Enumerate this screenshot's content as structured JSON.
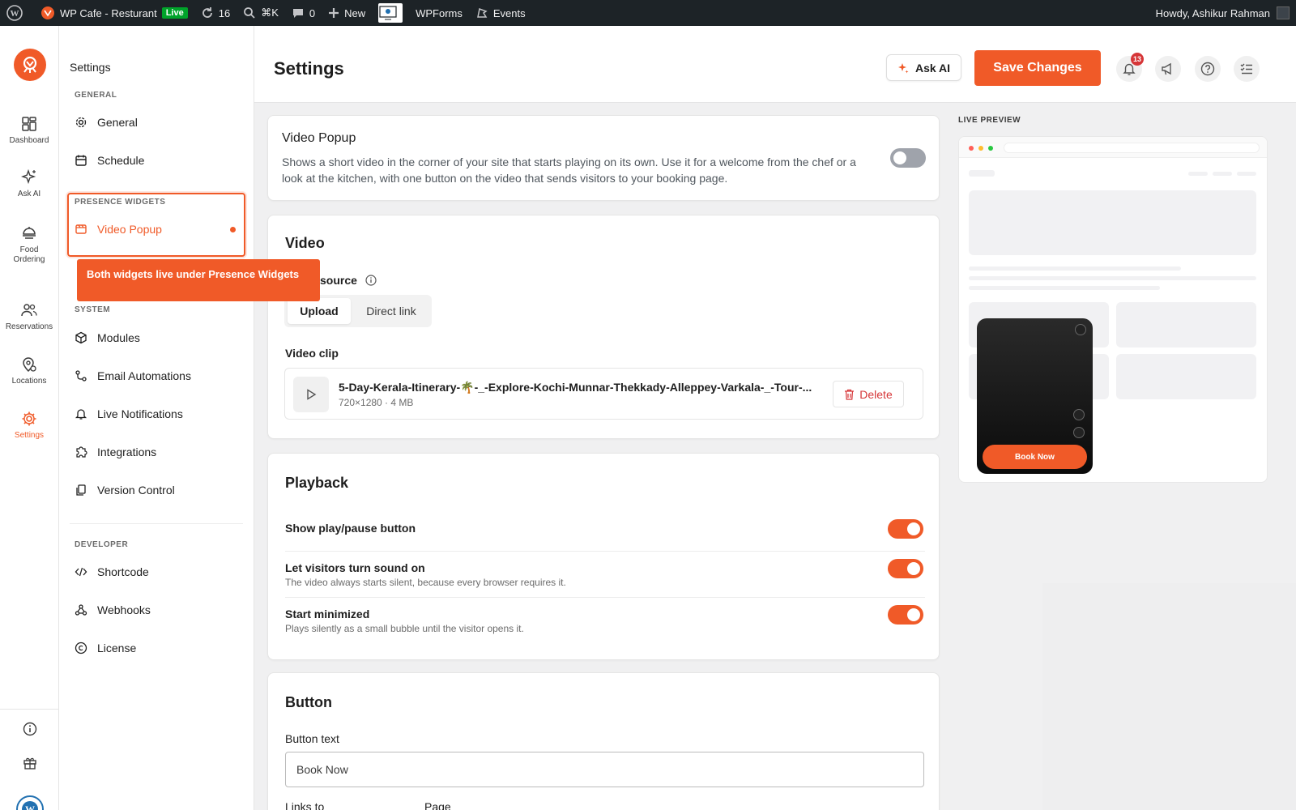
{
  "adminbar": {
    "site_name": "WP Cafe - Resturant",
    "live_badge": "Live",
    "updates_count": "16",
    "search_shortcut": "⌘K",
    "comments_count": "0",
    "new_label": "New",
    "wpforms_label": "WPForms",
    "events_label": "Events",
    "howdy": "Howdy, Ashikur Rahman"
  },
  "rail": {
    "items": [
      {
        "label": "Dashboard",
        "icon": "dashboard-icon"
      },
      {
        "label": "Ask AI",
        "icon": "sparkle-icon"
      },
      {
        "label": "Food Ordering",
        "icon": "food-icon"
      },
      {
        "label": "Reservations",
        "icon": "people-icon"
      },
      {
        "label": "Locations",
        "icon": "location-icon"
      },
      {
        "label": "Settings",
        "icon": "gear-icon"
      }
    ]
  },
  "settings_nav": {
    "title": "Settings",
    "section_general": "GENERAL",
    "general": "General",
    "schedule": "Schedule",
    "section_presence": "PRESENCE WIDGETS",
    "video_popup": "Video Popup",
    "section_system": "SYSTEM",
    "modules": "Modules",
    "email_automations": "Email Automations",
    "live_notifications": "Live Notifications",
    "integrations": "Integrations",
    "version_control": "Version Control",
    "section_developer": "DEVELOPER",
    "shortcode": "Shortcode",
    "webhooks": "Webhooks",
    "license": "License"
  },
  "tooltip": "Both widgets live under Presence Widgets",
  "header": {
    "title": "Settings",
    "ask_ai": "Ask AI",
    "save": "Save Changes",
    "notif_count": "13"
  },
  "video_popup_card": {
    "title": "Video Popup",
    "description": "Shows a short video in the corner of your site that starts playing on its own. Use it for a welcome from the chef or a look at the kitchen, with one button on the video that sends visitors to your booking page.",
    "enabled": false
  },
  "video_card": {
    "title": "Video",
    "source_label": "source",
    "tabs": [
      "Upload",
      "Direct link"
    ],
    "clip_label": "Video clip",
    "clip_name": "5-Day-Kerala-Itinerary-🌴-_-Explore-Kochi-Munnar-Thekkady-Alleppey-Varkala-_-Tour-...",
    "clip_meta": "720×1280 · 4 MB",
    "delete": "Delete"
  },
  "playback_card": {
    "title": "Playback",
    "rows": [
      {
        "label": "Show play/pause button",
        "help": "",
        "on": true
      },
      {
        "label": "Let visitors turn sound on",
        "help": "The video always starts silent, because every browser requires it.",
        "on": true
      },
      {
        "label": "Start minimized",
        "help": "Plays silently as a small bubble until the visitor opens it.",
        "on": true
      }
    ]
  },
  "button_card": {
    "title": "Button",
    "text_label": "Button text",
    "text_value": "Book Now",
    "links_to": "Links to",
    "page": "Page"
  },
  "live_preview": {
    "label": "LIVE PREVIEW",
    "button": "Book Now"
  },
  "colors": {
    "accent": "#f05a28",
    "adminbar": "#1d2327"
  }
}
